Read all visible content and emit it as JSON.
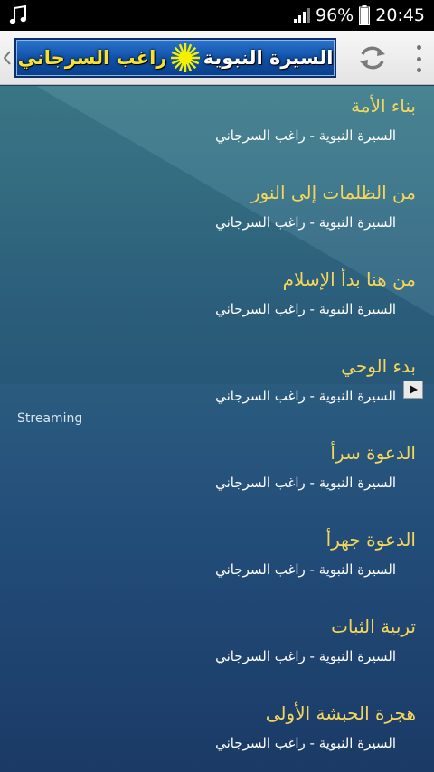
{
  "status_bar": {
    "battery": "96%",
    "time": "20:45"
  },
  "app_bar": {
    "banner_left": "السيرة النبوية",
    "banner_right": "راغب السرجاني"
  },
  "streaming_label": "Streaming",
  "items": [
    {
      "title": "بناء الأمة",
      "subtitle": "السيرة النبوية - راغب السرجاني"
    },
    {
      "title": "من الظلمات إلى النور",
      "subtitle": "السيرة النبوية - راغب السرجاني"
    },
    {
      "title": "من هنا بدأ الإسلام",
      "subtitle": "السيرة النبوية - راغب السرجاني"
    },
    {
      "title": "بدء الوحي",
      "subtitle": "السيرة النبوية - راغب السرجاني"
    },
    {
      "title": "الدعوة سرأ",
      "subtitle": "السيرة النبوية - راغب السرجاني"
    },
    {
      "title": "الدعوة جهرأ",
      "subtitle": "السيرة النبوية - راغب السرجاني"
    },
    {
      "title": "تربية الثبات",
      "subtitle": "السيرة النبوية - راغب السرجاني"
    },
    {
      "title": "هجرة الحبشة الأولى",
      "subtitle": "السيرة النبوية - راغب السرجاني"
    }
  ]
}
